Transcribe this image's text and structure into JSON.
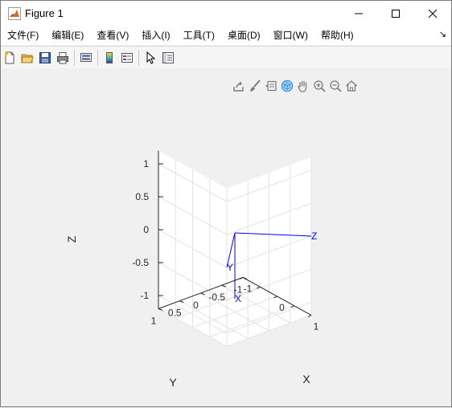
{
  "window": {
    "title": "Figure 1"
  },
  "menu": {
    "items": [
      "文件(F)",
      "编辑(E)",
      "查看(V)",
      "插入(I)",
      "工具(T)",
      "桌面(D)",
      "窗口(W)",
      "帮助(H)"
    ],
    "overflow_symbol": "↘"
  },
  "toolbar": {
    "buttons": [
      "new-figure-icon",
      "open-file-icon",
      "save-icon",
      "print-icon",
      "link-plot-icon",
      "colorbar-icon",
      "legend-icon",
      "pointer-icon",
      "property-inspector-icon"
    ]
  },
  "axes_toolbar": {
    "buttons": [
      "export-icon",
      "brush-icon",
      "data-tip-icon",
      "rotate-3d-icon",
      "pan-icon",
      "zoom-in-icon",
      "zoom-out-icon",
      "home-icon"
    ]
  },
  "chart_data": {
    "type": "line",
    "projection": "3d-isometric",
    "xlabel": "X",
    "ylabel": "Y",
    "zlabel": "Z",
    "xlim": [
      -1,
      1
    ],
    "ylim": [
      -1,
      1
    ],
    "zlim": [
      -1.2,
      1.2
    ],
    "xticks": [
      "-1",
      "0",
      "1"
    ],
    "yticks": [
      "1",
      "0.5",
      "0",
      "-0.5",
      "-1"
    ],
    "zticks": [
      "1",
      "0.5",
      "0",
      "-0.5",
      "-1"
    ],
    "grid": true,
    "series": [
      {
        "name": "X",
        "color": "#0000ff",
        "from": [
          0,
          0,
          0
        ],
        "to": [
          0,
          0,
          -1
        ]
      },
      {
        "name": "Y",
        "color": "#0000ff",
        "from": [
          0,
          0,
          0
        ],
        "to": [
          1,
          1,
          0
        ]
      },
      {
        "name": "Z",
        "color": "#0000ff",
        "from": [
          0,
          0,
          0
        ],
        "to": [
          1,
          -1,
          0
        ]
      }
    ]
  }
}
